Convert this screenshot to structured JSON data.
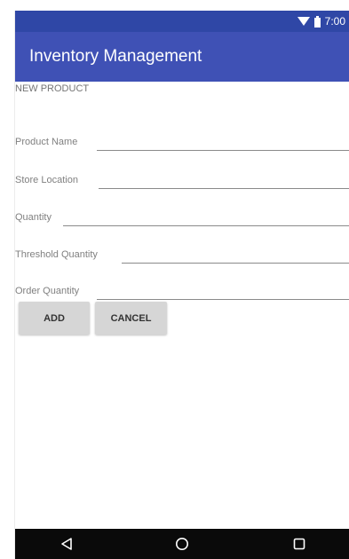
{
  "status_bar": {
    "time": "7:00",
    "icons": [
      "wifi-icon",
      "battery-icon"
    ]
  },
  "app_bar": {
    "title": "Inventory Management"
  },
  "form": {
    "section_title": "NEW PRODUCT",
    "fields": [
      {
        "label": "Product Name",
        "value": "",
        "placeholder": ""
      },
      {
        "label": "Store Location",
        "value": "",
        "placeholder": ""
      },
      {
        "label": "Quantity",
        "value": "",
        "placeholder": ""
      },
      {
        "label": "Threshold Quantity",
        "value": "",
        "placeholder": ""
      },
      {
        "label": "Order Quantity",
        "value": "",
        "placeholder": ""
      }
    ],
    "add_label": "ADD",
    "cancel_label": "CANCEL"
  },
  "nav_bar": {
    "icons": [
      "back-icon",
      "home-icon",
      "recents-icon"
    ]
  },
  "colors": {
    "status_bar": "#2f47a6",
    "app_bar": "#3f51b5",
    "button": "#d6d6d6",
    "nav_bar": "#0a0a0a"
  }
}
